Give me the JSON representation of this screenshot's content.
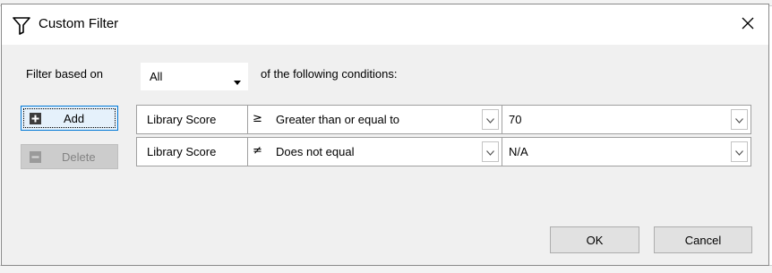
{
  "dialog": {
    "title": "Custom Filter",
    "title_icon": "funnel-icon",
    "close_icon": "close-icon"
  },
  "filter_header": {
    "prefix_label": "Filter based on",
    "match_mode": "All",
    "suffix_label": "of the following conditions:"
  },
  "buttons": {
    "add_label": "Add",
    "add_icon": "plus-icon",
    "delete_label": "Delete",
    "delete_icon": "minus-icon",
    "ok_label": "OK",
    "cancel_label": "Cancel"
  },
  "conditions": [
    {
      "field": "Library Score",
      "operator_symbol": "≥",
      "operator_label": "Greater than or equal to",
      "value": "70"
    },
    {
      "field": "Library Score",
      "operator_symbol": "≠",
      "operator_label": "Does not equal",
      "value": "N/A"
    }
  ],
  "colors": {
    "dialog_bg": "#f0f0f0",
    "focus_border": "#0078d7",
    "disabled_text": "#838383"
  }
}
